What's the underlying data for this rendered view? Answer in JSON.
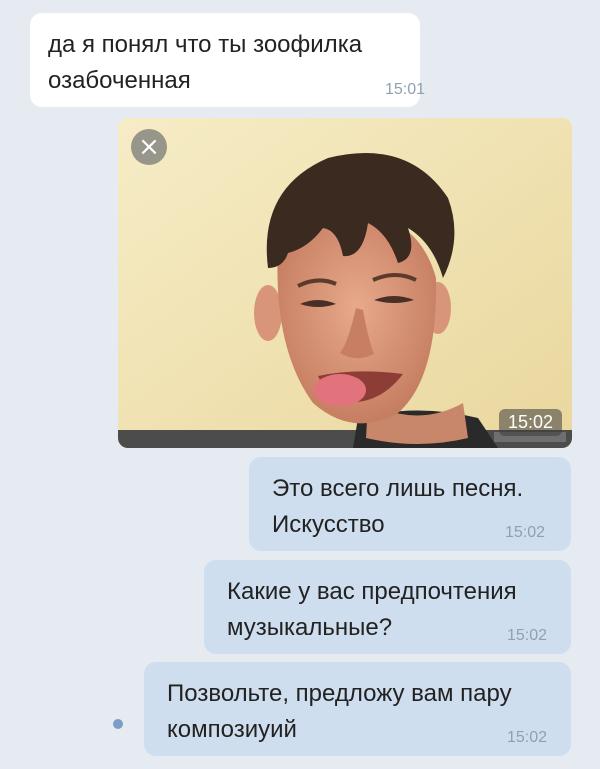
{
  "messages": [
    {
      "text": "да я понял что ты зоофилка\nозабоченная",
      "time": "15:01"
    },
    {
      "type": "photo",
      "time": "15:02",
      "close_icon": "close-icon",
      "image": "meme-photo-man-licking-lips"
    },
    {
      "text": "Это всего лишь песня.\nИскусство",
      "time": "15:02"
    },
    {
      "text": "Какие у вас предпочтения\nмузыкальные?",
      "time": "15:02"
    },
    {
      "text": "Позвольте, предложу вам пару\nкомпозиуий",
      "time": "15:02"
    }
  ],
  "colors": {
    "background": "#e6ebf1",
    "incoming_bubble": "#ffffff",
    "outgoing_bubble": "#cfdeee",
    "time_text": "#8fa0b3",
    "unread_dot": "#7c9ec6"
  }
}
